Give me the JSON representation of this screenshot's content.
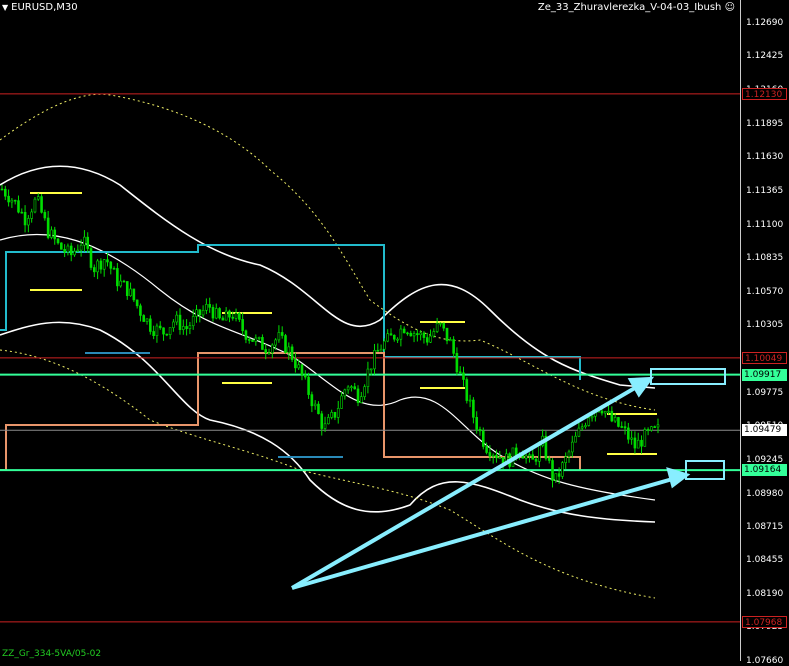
{
  "header": {
    "symbol_timeframe": "EURUSD,M30",
    "indicator_name": "Ze_33_Zhuravlerezka_V-04-03_Ibush",
    "indicator_icon": "smiley-icon"
  },
  "footer": {
    "label": "ZZ_Gr_334-5VA/05-02"
  },
  "price_axis": {
    "ticks": [
      "1.12690",
      "1.12425",
      "1.12160",
      "1.11895",
      "1.11630",
      "1.11365",
      "1.11100",
      "1.10835",
      "1.10570",
      "1.10305",
      "1.10040",
      "1.09775",
      "1.09510",
      "1.09245",
      "1.08980",
      "1.08715",
      "1.08455",
      "1.08190",
      "1.07925",
      "1.07660"
    ],
    "current_price": "1.09479",
    "levels": [
      {
        "value": "1.12130",
        "color": "#cc2222",
        "style": "red-box"
      },
      {
        "value": "1.10049",
        "color": "#cc2222",
        "style": "red-box"
      },
      {
        "value": "1.09917",
        "color": "#33ff99",
        "style": "green-fill"
      },
      {
        "value": "1.09164",
        "color": "#33ff99",
        "style": "green-fill"
      },
      {
        "value": "1.07968",
        "color": "#cc2222",
        "style": "red-box"
      }
    ]
  },
  "chart_data": {
    "type": "line",
    "symbol": "EURUSD",
    "timeframe": "M30",
    "ylim": [
      1.0766,
      1.1287
    ],
    "close_path": [
      1.1138,
      1.1129,
      1.1115,
      1.113,
      1.1105,
      1.1092,
      1.1086,
      1.1098,
      1.1076,
      1.1084,
      1.1066,
      1.1058,
      1.1042,
      1.1029,
      1.1025,
      1.1035,
      1.1028,
      1.1038,
      1.1046,
      1.1033,
      1.104,
      1.1026,
      1.1018,
      1.1013,
      1.1021,
      1.101,
      1.0992,
      1.097,
      1.0949,
      1.0962,
      1.0985,
      1.0975,
      1.0999,
      1.1015,
      1.1022,
      1.103,
      1.1024,
      1.102,
      1.1031,
      1.1016,
      1.0985,
      1.0958,
      1.0936,
      1.0929,
      1.0924,
      1.0934,
      1.0921,
      1.0938,
      1.0906,
      1.0925,
      1.0944,
      1.0961,
      1.0968,
      1.0955,
      1.0948,
      1.0935,
      1.0944,
      1.0948
    ],
    "colors": {
      "candles": "#00dd00",
      "bands": "#ffffff",
      "cyan_level": "#22bbcc",
      "orange_level": "#e8956a",
      "yellow": "#ffff44",
      "arrows": "#88eeff"
    }
  }
}
